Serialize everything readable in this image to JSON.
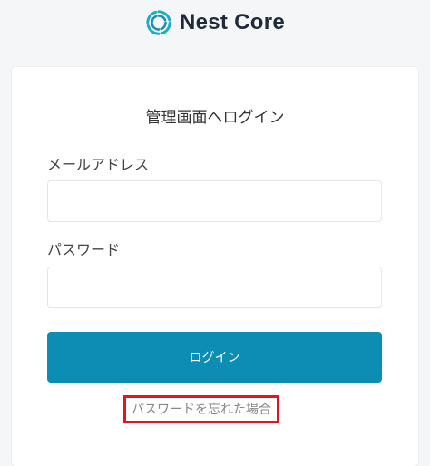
{
  "header": {
    "brand": "Nest Core",
    "logo_icon": "nest-core-logo-icon",
    "accent_color": "#0b8db4"
  },
  "login": {
    "title": "管理画面へログイン",
    "email_label": "メールアドレス",
    "email_value": "",
    "email_placeholder": "",
    "password_label": "パスワード",
    "password_value": "",
    "password_placeholder": "",
    "submit_label": "ログイン",
    "forgot_link": "パスワードを忘れた場合",
    "forgot_highlight_color": "#e8121f"
  }
}
